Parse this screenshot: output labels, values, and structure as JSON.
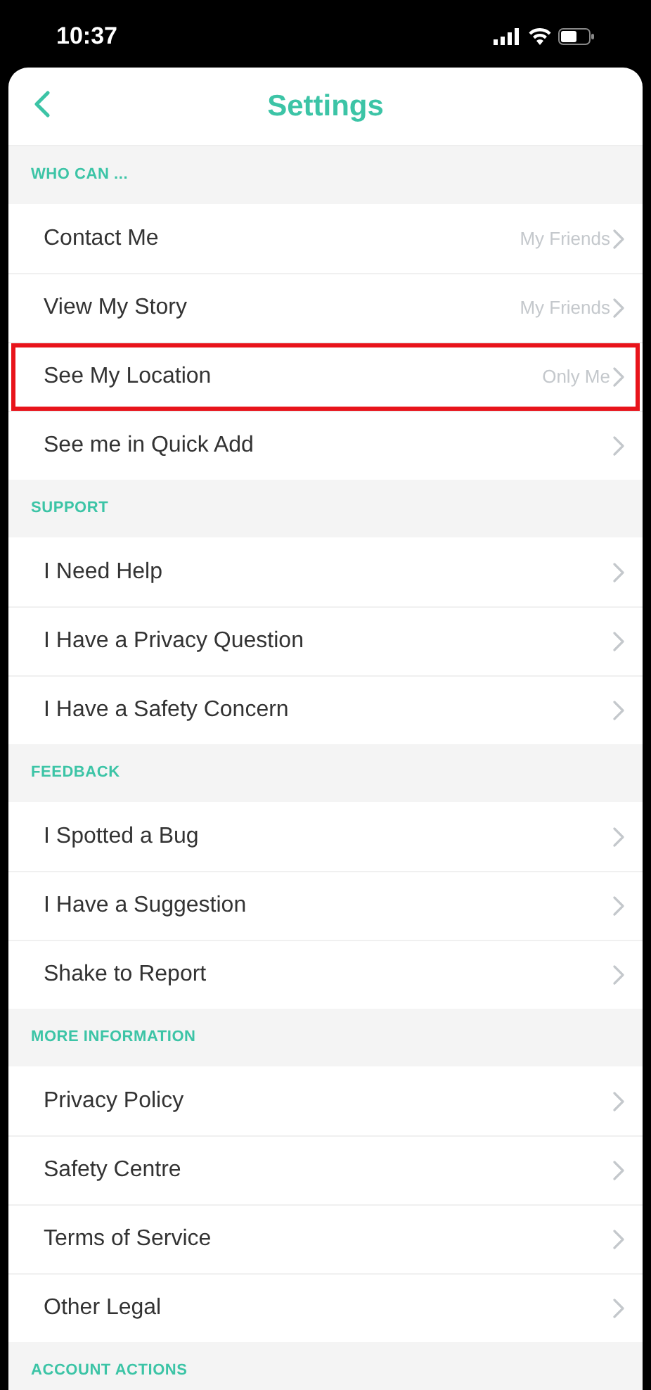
{
  "status_bar": {
    "time": "10:37"
  },
  "header": {
    "title": "Settings"
  },
  "sections": [
    {
      "title": "WHO CAN ...",
      "items": [
        {
          "label": "Contact Me",
          "value": "My Friends",
          "highlighted": false
        },
        {
          "label": "View My Story",
          "value": "My Friends",
          "highlighted": false
        },
        {
          "label": "See My Location",
          "value": "Only Me",
          "highlighted": true
        },
        {
          "label": "See me in Quick Add",
          "highlighted": false
        }
      ]
    },
    {
      "title": "SUPPORT",
      "items": [
        {
          "label": "I Need Help",
          "highlighted": false
        },
        {
          "label": "I Have a Privacy Question",
          "highlighted": false
        },
        {
          "label": "I Have a Safety Concern",
          "highlighted": false
        }
      ]
    },
    {
      "title": "FEEDBACK",
      "items": [
        {
          "label": "I Spotted a Bug",
          "highlighted": false
        },
        {
          "label": "I Have a Suggestion",
          "highlighted": false
        },
        {
          "label": "Shake to Report",
          "highlighted": false
        }
      ]
    },
    {
      "title": "MORE INFORMATION",
      "items": [
        {
          "label": "Privacy Policy",
          "highlighted": false
        },
        {
          "label": "Safety Centre",
          "highlighted": false
        },
        {
          "label": "Terms of Service",
          "highlighted": false
        },
        {
          "label": "Other Legal",
          "highlighted": false
        }
      ]
    },
    {
      "title": "ACCOUNT ACTIONS"
    }
  ]
}
